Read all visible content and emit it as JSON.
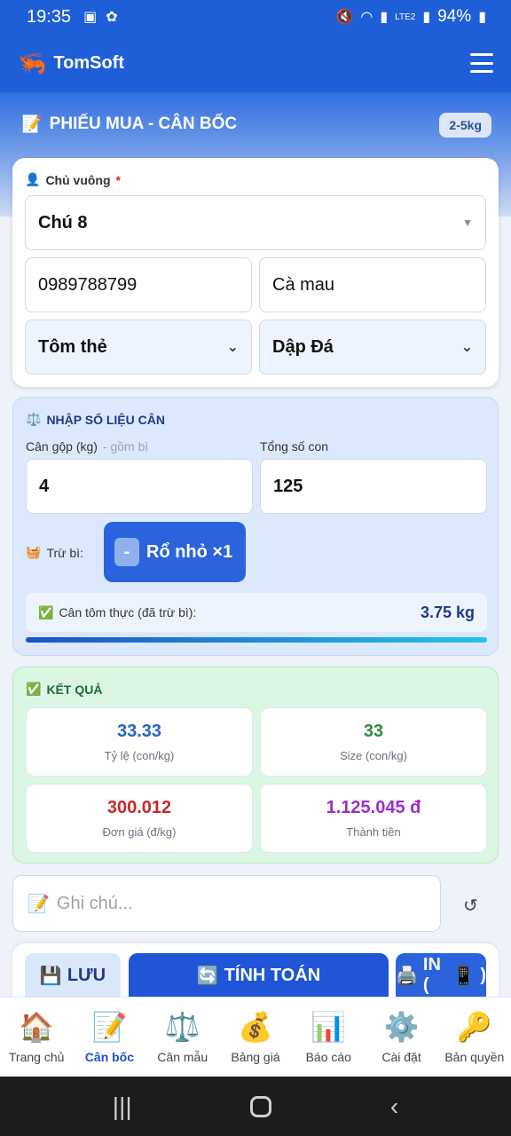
{
  "status_bar": {
    "time": "19:35",
    "battery": "94%",
    "network": "LTE2"
  },
  "app": {
    "name": "TomSoft"
  },
  "section": {
    "title": "PHIẾU MUA - CÂN BỐC",
    "badge": "2-5kg"
  },
  "owner": {
    "label": "Chủ vuông",
    "required_mark": "*",
    "name_value": "Chú 8",
    "phone_value": "0989788799",
    "address_value": "Cà mau",
    "shrimp_type": "Tôm thẻ",
    "method": "Dập Đá"
  },
  "weigh": {
    "title": "NHẬP SỐ LIỆU CÂN",
    "gross_label": "Cân gộp (kg)",
    "gross_hint": "- gồm bì",
    "gross_value": "4",
    "count_label": "Tổng số con",
    "count_value": "125",
    "tare_label": "Trừ bì:",
    "tare_button_minus": "-",
    "tare_button": "Rổ nhỏ ×1",
    "net_label": "Cân tôm thực (đã trừ bì):",
    "net_value": "3.75 kg",
    "progress": 1.0
  },
  "result": {
    "title": "KẾT QUẢ",
    "ratio_value": "33.33",
    "ratio_label": "Tỷ lệ (con/kg)",
    "size_value": "33",
    "size_label": "Size (con/kg)",
    "price_value": "300.012",
    "price_label": "Đơn giá (đ/kg)",
    "total_value": "1.125.045 đ",
    "total_label": "Thành tiền"
  },
  "note": {
    "placeholder": "Ghi chú..."
  },
  "actions": {
    "save": "LƯU",
    "calc": "TÍNH TOÁN",
    "print": "IN (",
    "print_suffix": ")"
  },
  "nav": [
    {
      "label": "Trang chủ",
      "icon": "house-icon"
    },
    {
      "label": "Cân bốc",
      "icon": "memo-icon"
    },
    {
      "label": "Cân mẫu",
      "icon": "scale-icon"
    },
    {
      "label": "Bảng giá",
      "icon": "money-bag-icon"
    },
    {
      "label": "Báo cáo",
      "icon": "chart-icon"
    },
    {
      "label": "Cài đặt",
      "icon": "gear-icon"
    },
    {
      "label": "Bản quyền",
      "icon": "key-icon"
    }
  ],
  "colors": {
    "primary": "#1e5fd8",
    "ratio": "#2a63c8",
    "size": "#2e8b3e",
    "price": "#c62828",
    "total": "#9b30c8"
  }
}
